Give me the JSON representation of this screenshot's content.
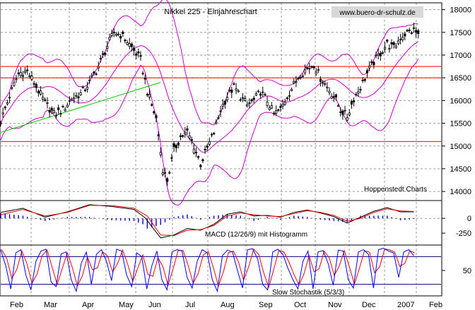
{
  "title": "Nikkei 225 - Einjahreschart",
  "watermark": "www.buero-dr-schulz.de",
  "credit": "Hoppenstedt Charts",
  "macd_label": "MACD (12/26/9) mit Histogramm",
  "stoch_label": "Slow Stochastik (5/3/3)",
  "colors": {
    "price": "#000000",
    "bands": "#cc00cc",
    "support": "#ff0000",
    "trend": "#00cc00",
    "macd": "#000000",
    "signal": "#ff0000",
    "histogram": "#0000cc",
    "stoch_k": "#0000ff",
    "stoch_d": "#ff0000",
    "stoch_ref": "#000080",
    "grid": "#999999"
  },
  "chart_data": [
    {
      "type": "ohlc",
      "title": "Nikkei 225 - Einjahreschart",
      "x_months": [
        "Feb",
        "Mar",
        "Apr",
        "May",
        "Jun",
        "Jul",
        "Aug",
        "Sep",
        "Oct",
        "Nov",
        "Dec",
        "2007",
        "Feb"
      ],
      "yticks": [
        14000,
        14500,
        15000,
        15500,
        16000,
        16500,
        17000,
        17500,
        18000
      ],
      "ylim": [
        13800,
        18150
      ],
      "price_path": [
        [
          0,
          15550
        ],
        [
          4,
          16100
        ],
        [
          8,
          16600
        ],
        [
          12,
          16650
        ],
        [
          16,
          16300
        ],
        [
          20,
          15950
        ],
        [
          24,
          15700
        ],
        [
          28,
          15800
        ],
        [
          32,
          16050
        ],
        [
          36,
          16150
        ],
        [
          40,
          16400
        ],
        [
          44,
          16750
        ],
        [
          48,
          17200
        ],
        [
          51,
          17500
        ],
        [
          54,
          17450
        ],
        [
          57,
          17300
        ],
        [
          60,
          17100
        ],
        [
          63,
          16900
        ],
        [
          66,
          16200
        ],
        [
          70,
          15600
        ],
        [
          73,
          14500
        ],
        [
          75,
          14250
        ],
        [
          78,
          14900
        ],
        [
          81,
          15200
        ],
        [
          84,
          15300
        ],
        [
          87,
          15000
        ],
        [
          90,
          14600
        ],
        [
          93,
          14950
        ],
        [
          96,
          15300
        ],
        [
          99,
          15800
        ],
        [
          102,
          16100
        ],
        [
          105,
          16300
        ],
        [
          108,
          16100
        ],
        [
          111,
          15900
        ],
        [
          114,
          16000
        ],
        [
          117,
          16200
        ],
        [
          120,
          16000
        ],
        [
          123,
          15700
        ],
        [
          126,
          15800
        ],
        [
          129,
          16100
        ],
        [
          132,
          16350
        ],
        [
          135,
          16600
        ],
        [
          138,
          16700
        ],
        [
          141,
          16800
        ],
        [
          144,
          16500
        ],
        [
          147,
          16300
        ],
        [
          150,
          16100
        ],
        [
          153,
          15800
        ],
        [
          156,
          15650
        ],
        [
          159,
          16050
        ],
        [
          162,
          16300
        ],
        [
          165,
          16600
        ],
        [
          168,
          16850
        ],
        [
          171,
          17050
        ],
        [
          174,
          17250
        ],
        [
          177,
          17150
        ],
        [
          180,
          17400
        ],
        [
          183,
          17500
        ],
        [
          186,
          17550
        ],
        [
          188,
          17450
        ]
      ],
      "resistance_levels": [
        16750,
        16500,
        15100
      ],
      "trendline": [
        [
          0,
          15300
        ],
        [
          72,
          16400
        ]
      ]
    },
    {
      "type": "line",
      "title": "MACD (12/26/9) mit Histogramm",
      "yticks": [
        0,
        -250
      ],
      "ylim": [
        -450,
        300
      ],
      "macd_path": [
        [
          0,
          100
        ],
        [
          10,
          170
        ],
        [
          20,
          20
        ],
        [
          30,
          110
        ],
        [
          40,
          230
        ],
        [
          50,
          200
        ],
        [
          60,
          150
        ],
        [
          65,
          10
        ],
        [
          72,
          -330
        ],
        [
          78,
          -280
        ],
        [
          84,
          -170
        ],
        [
          90,
          -200
        ],
        [
          96,
          -100
        ],
        [
          102,
          70
        ],
        [
          108,
          110
        ],
        [
          114,
          40
        ],
        [
          120,
          50
        ],
        [
          126,
          20
        ],
        [
          132,
          100
        ],
        [
          138,
          140
        ],
        [
          144,
          90
        ],
        [
          150,
          30
        ],
        [
          156,
          -80
        ],
        [
          162,
          20
        ],
        [
          168,
          120
        ],
        [
          174,
          180
        ],
        [
          180,
          110
        ],
        [
          186,
          110
        ]
      ],
      "signal_path": [
        [
          0,
          60
        ],
        [
          10,
          150
        ],
        [
          20,
          40
        ],
        [
          30,
          100
        ],
        [
          40,
          220
        ],
        [
          50,
          215
        ],
        [
          60,
          170
        ],
        [
          66,
          40
        ],
        [
          72,
          -280
        ],
        [
          78,
          -290
        ],
        [
          84,
          -200
        ],
        [
          90,
          -190
        ],
        [
          96,
          -120
        ],
        [
          102,
          40
        ],
        [
          108,
          90
        ],
        [
          114,
          60
        ],
        [
          120,
          40
        ],
        [
          126,
          30
        ],
        [
          132,
          80
        ],
        [
          138,
          130
        ],
        [
          144,
          100
        ],
        [
          150,
          50
        ],
        [
          156,
          -50
        ],
        [
          162,
          0
        ],
        [
          168,
          100
        ],
        [
          174,
          160
        ],
        [
          180,
          125
        ],
        [
          186,
          115
        ]
      ]
    },
    {
      "type": "line",
      "title": "Slow Stochastik (5/3/3)",
      "yticks": [
        50
      ],
      "ylim": [
        -5,
        105
      ],
      "reference_levels": [
        80,
        20
      ],
      "k_points": [
        95,
        60,
        10,
        88,
        95,
        40,
        8,
        70,
        92,
        96,
        25,
        15,
        86,
        90,
        30,
        5,
        66,
        90,
        20,
        85,
        95,
        70,
        28,
        96,
        92,
        40,
        15,
        88,
        80,
        10,
        60,
        92,
        30,
        8,
        90,
        95,
        92,
        35,
        12,
        70,
        95,
        88,
        30,
        5,
        82,
        94,
        90,
        50,
        12,
        95,
        97,
        75,
        20,
        8,
        90,
        96,
        85,
        55,
        30,
        10,
        70,
        92,
        10,
        90,
        93,
        65,
        18,
        94,
        92,
        30,
        12,
        90,
        95,
        85,
        12,
        95,
        98,
        92,
        88,
        35,
        90,
        95,
        82
      ],
      "x_months": [
        "Feb",
        "Mar",
        "Apr",
        "May",
        "Jun",
        "Jul",
        "Aug",
        "Sep",
        "Oct",
        "Nov",
        "Dec",
        "2007",
        "Feb"
      ]
    }
  ]
}
